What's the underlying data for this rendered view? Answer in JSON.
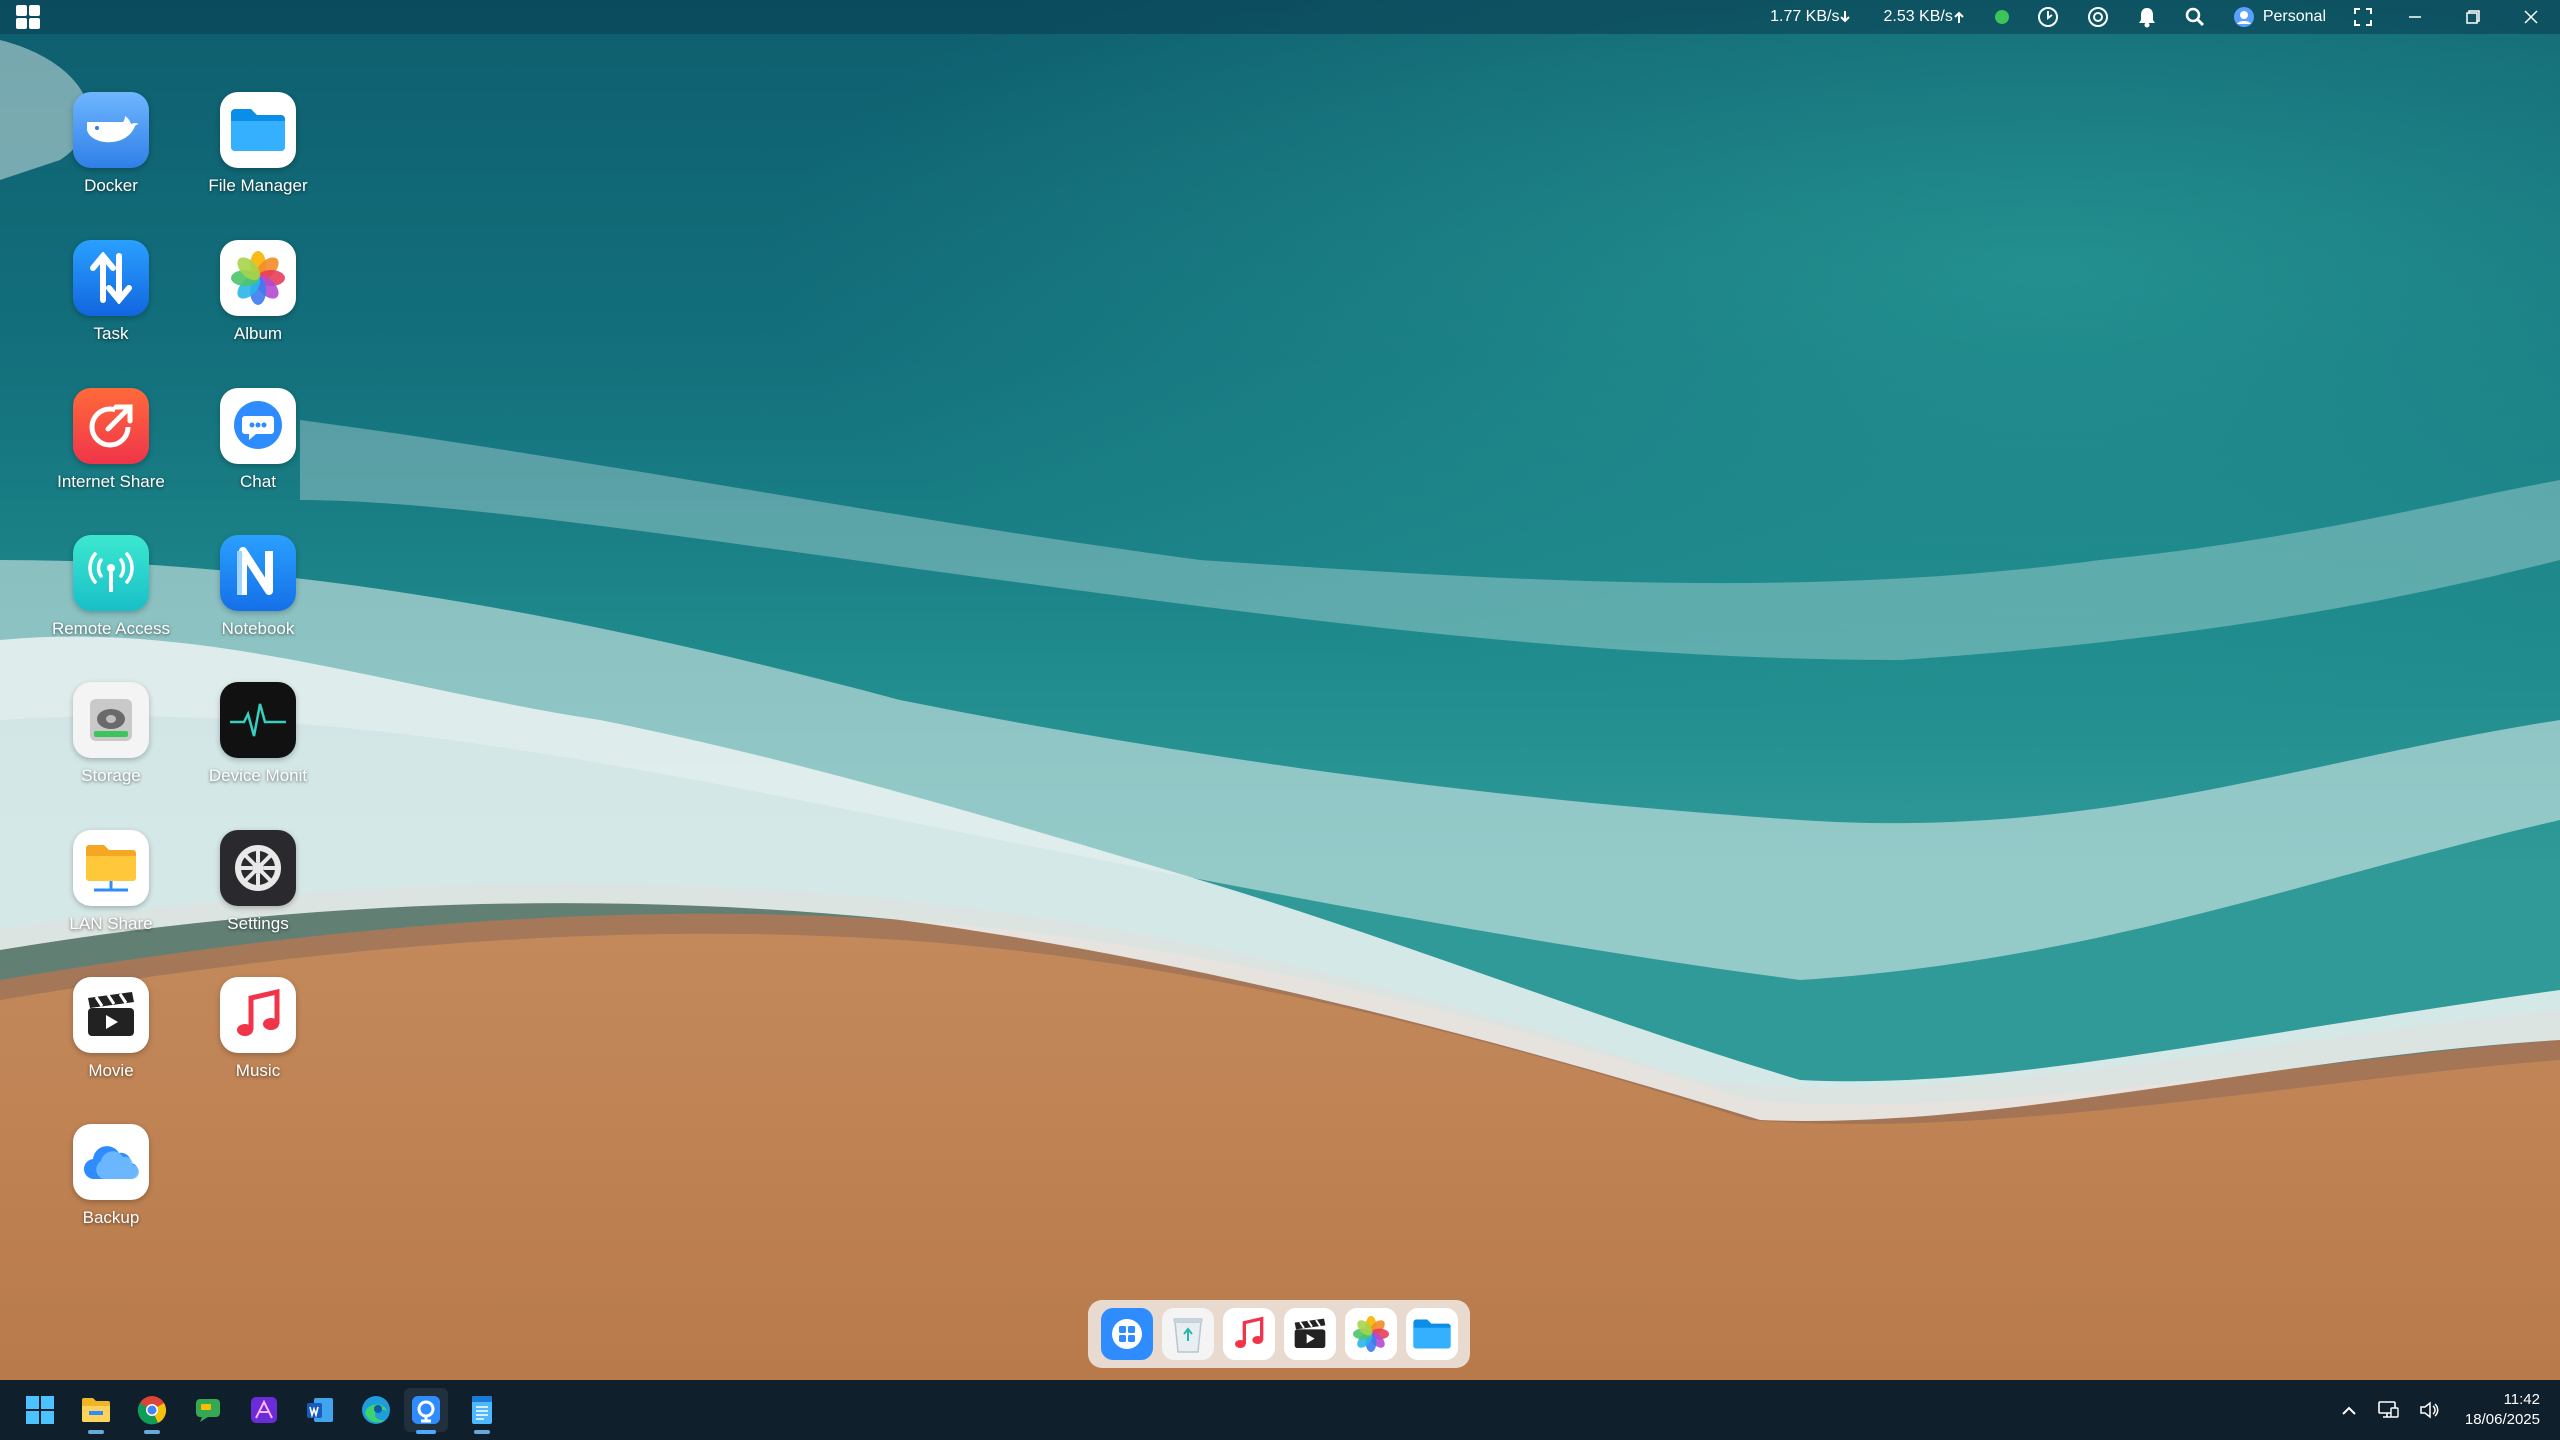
{
  "topbar": {
    "download_speed": "1.77 KB/s",
    "upload_speed": "2.53 KB/s",
    "user_label": "Personal"
  },
  "desktop_icons": [
    {
      "label": "Docker",
      "icon": "docker-icon"
    },
    {
      "label": "File Manager",
      "icon": "folder-icon"
    },
    {
      "label": "Task",
      "icon": "transfer-arrows-icon"
    },
    {
      "label": "Album",
      "icon": "photos-flower-icon"
    },
    {
      "label": "Internet Share",
      "icon": "share-link-icon"
    },
    {
      "label": "Chat",
      "icon": "chat-bubble-icon"
    },
    {
      "label": "Remote Access",
      "icon": "antenna-icon"
    },
    {
      "label": "Notebook",
      "icon": "notebook-n-icon"
    },
    {
      "label": "Storage",
      "icon": "hard-drive-icon"
    },
    {
      "label": "Device Monit",
      "icon": "heartbeat-monitor-icon"
    },
    {
      "label": "LAN Share",
      "icon": "lan-folder-icon"
    },
    {
      "label": "Settings",
      "icon": "gear-icon"
    },
    {
      "label": "Movie",
      "icon": "clapperboard-icon"
    },
    {
      "label": "Music",
      "icon": "music-note-icon"
    },
    {
      "label": "Backup",
      "icon": "cloud-backup-icon"
    }
  ],
  "dock_items": [
    "app-grid-icon",
    "recycle-bin-icon",
    "music-note-icon",
    "clapperboard-icon",
    "photos-flower-icon",
    "folder-icon"
  ],
  "taskbar": {
    "apps": [
      "windows-start-icon",
      "file-explorer-icon",
      "chrome-icon",
      "chat-app-icon",
      "affinity-icon",
      "word-icon",
      "edge-icon",
      "nas-client-icon",
      "notepad-icon"
    ],
    "time": "11:42",
    "date": "18/06/2025"
  },
  "colors": {
    "accent": "#2f8cff",
    "topbar_bg": "#0a3c50",
    "taskbar_bg": "#0f1f2c",
    "status_online": "#3cc45a"
  }
}
